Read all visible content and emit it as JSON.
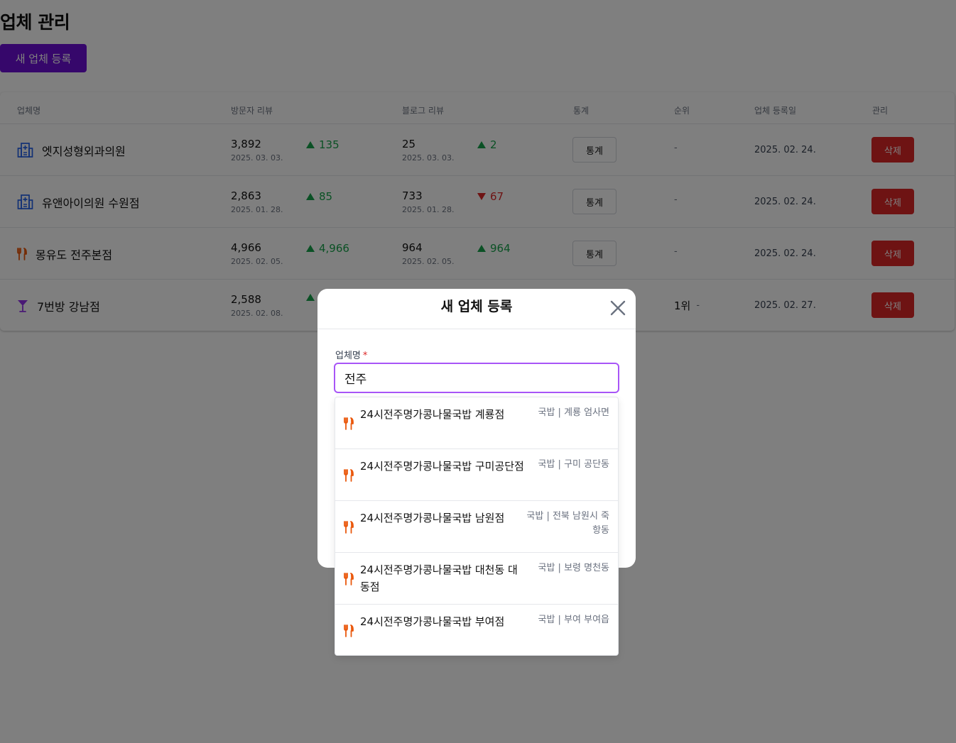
{
  "page": {
    "title": "업체 관리",
    "add_button": "새 업체 등록"
  },
  "table": {
    "headers": [
      "업체명",
      "방문자 리뷰",
      "블로그 리뷰",
      "통계",
      "순위",
      "업체 등록일",
      "관리"
    ],
    "rows": [
      {
        "icon": "hospital-icon",
        "name": "엣지성형외과의원",
        "visitor_count": "3,892",
        "visitor_date": "2025. 03. 03.",
        "visitor_delta": "135",
        "visitor_dir": "up",
        "blog_count": "25",
        "blog_date": "2025. 03. 03.",
        "blog_delta": "2",
        "blog_dir": "up",
        "stats_label": "통계",
        "rank": "",
        "rank_delta": "-",
        "reg_date": "2025. 02. 24.",
        "delete_label": "삭제"
      },
      {
        "icon": "hospital-icon",
        "name": "유앤아이의원 수원점",
        "visitor_count": "2,863",
        "visitor_date": "2025. 01. 28.",
        "visitor_delta": "85",
        "visitor_dir": "up",
        "blog_count": "733",
        "blog_date": "2025. 01. 28.",
        "blog_delta": "67",
        "blog_dir": "down",
        "stats_label": "통계",
        "rank": "",
        "rank_delta": "-",
        "reg_date": "2025. 02. 24.",
        "delete_label": "삭제"
      },
      {
        "icon": "utensils-icon",
        "name": "몽유도 전주본점",
        "visitor_count": "4,966",
        "visitor_date": "2025. 02. 05.",
        "visitor_delta": "4,966",
        "visitor_dir": "up",
        "blog_count": "964",
        "blog_date": "2025. 02. 05.",
        "blog_delta": "964",
        "blog_dir": "up",
        "stats_label": "통계",
        "rank": "",
        "rank_delta": "-",
        "reg_date": "2025. 02. 24.",
        "delete_label": "삭제"
      },
      {
        "icon": "cocktail-icon",
        "name": "7번방 강남점",
        "visitor_count": "2,588",
        "visitor_date": "2025. 02. 08.",
        "visitor_delta": "",
        "visitor_dir": "up",
        "blog_count": "",
        "blog_date": "",
        "blog_delta": "",
        "blog_dir": "up",
        "stats_label": "",
        "rank": "1위",
        "rank_delta": "-",
        "reg_date": "2025. 02. 27.",
        "delete_label": "삭제"
      }
    ]
  },
  "modal": {
    "title": "새 업체 등록",
    "field_label": "업체명",
    "required_mark": "*",
    "input_value": "전주",
    "suggestions": [
      {
        "name": "24시전주명가콩나물국밥 계룡점",
        "meta": "국밥 | 계룡 엄사면"
      },
      {
        "name": "24시전주명가콩나물국밥 구미공단점",
        "meta": "국밥 | 구미 공단동"
      },
      {
        "name": "24시전주명가콩나물국밥 남원점",
        "meta": "국밥 | 전북 남원시 죽항동"
      },
      {
        "name": "24시전주명가콩나물국밥 대천동 대동점",
        "meta": "국밥 | 보령 명천동"
      },
      {
        "name": "24시전주명가콩나물국밥 부여점",
        "meta": "국밥 | 부여 부여읍"
      }
    ]
  },
  "colors": {
    "primary": "#6d0fd6",
    "danger": "#dc2626",
    "up": "#16a34a",
    "down": "#dc2626",
    "focus": "#a855f7",
    "food_icon": "#ea580c",
    "hospital_icon": "#2563eb",
    "bar_icon": "#9333ea"
  }
}
